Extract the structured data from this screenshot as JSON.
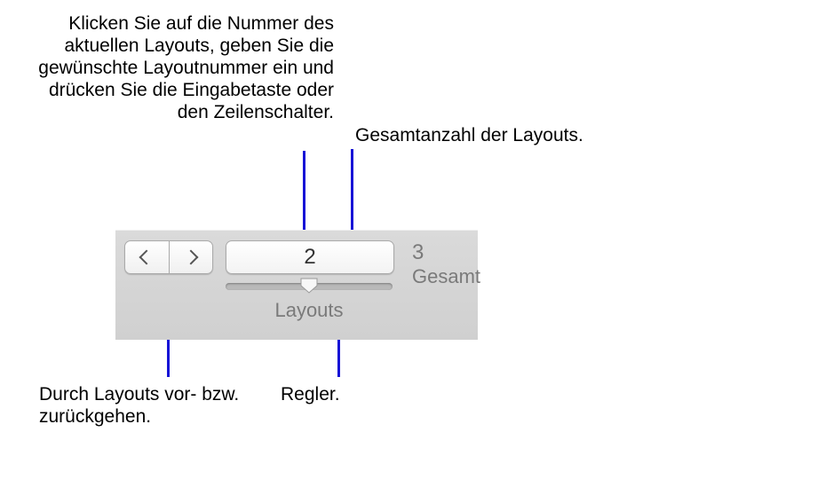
{
  "captions": {
    "numberfield": "Klicken Sie auf die Nummer des aktuellen Layouts, geben Sie die gewünschte Layoutnummer ein und drücken Sie die Eingabetaste oder den Zeilenschalter.",
    "total": "Gesamtanzahl der Layouts.",
    "nav": "Durch Layouts vor- bzw. zurückgehen.",
    "slider": "Regler."
  },
  "panel": {
    "current_layout": "2",
    "total_count": "3",
    "total_label": "Gesamt",
    "section_label": "Layouts",
    "slider_position_pct": 50
  },
  "icons": {
    "prev": "chevron-left",
    "next": "chevron-right"
  },
  "colors": {
    "leader": "#1714d6",
    "panel_text_muted": "#7a7a7a"
  }
}
